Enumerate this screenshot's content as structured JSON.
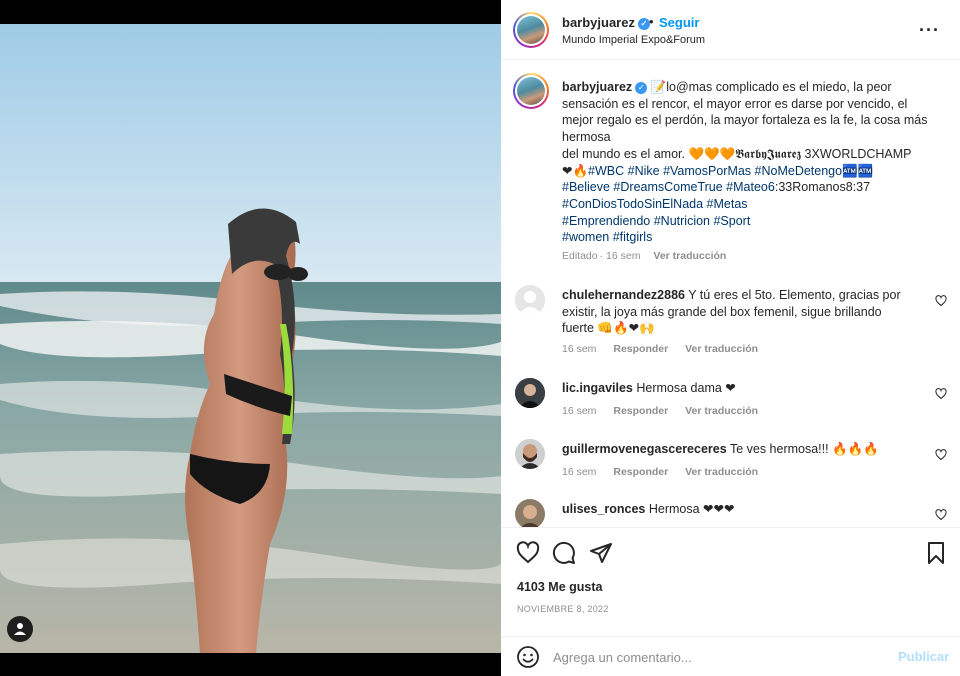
{
  "post": {
    "username": "barbyjuarez",
    "verified_mark": "✓",
    "separator": "•",
    "follow_label": "Seguir",
    "location": "Mundo Imperial Expo&Forum",
    "more_icon": "more-horizontal-icon",
    "more_label": "···"
  },
  "caption": {
    "username": "barbyjuarez",
    "line1": "📝lo@mas complicado es el miedo, la peor sensación es el rencor, el mayor error es darse por vencido, el mejor regalo es el perdón, la mayor fortaleza es la fe, la cosa más hermosa",
    "line2": "del mundo es el amor. 🧡🧡🧡𝕭𝖆𝖗𝖇𝖞𝕵𝖚𝖆𝖗𝖊𝖟 3XWORLDCHAMP",
    "line3_prefix": "❤🔥",
    "tags_a": "#WBC #Nike #VamosPorMas #NoMeDetengo",
    "line3_suffix": "🏧🏧",
    "tags_b": "#Believe #DreamsComeTrue #Mateo6",
    "line4_plain": ":33Romanos8:37",
    "tags_c": "#ConDiosTodoSinElNada #Metas",
    "tags_d": "#Emprendiendo #Nutricion #Sport",
    "tags_e": "#women #fitgirls",
    "edited": "Editado",
    "time": "16 sem",
    "translate": "Ver traducción"
  },
  "comments": [
    {
      "username": "chulehernandez2886",
      "text": "Y tú eres el 5to. Elemento, gracias por existir, la joya más grande del box femenil, sigue brillando fuerte 👊🔥❤🙌",
      "time": "16 sem",
      "reply": "Responder",
      "translate": "Ver traducción"
    },
    {
      "username": "lic.ingaviles",
      "text": "Hermosa dama ❤",
      "time": "16 sem",
      "reply": "Responder",
      "translate": "Ver traducción"
    },
    {
      "username": "guillermovenegascereceres",
      "text": "Te ves hermosa!!! 🔥🔥🔥",
      "time": "16 sem",
      "reply": "Responder",
      "translate": "Ver traducción"
    },
    {
      "username": "ulises_ronces",
      "text": "Hermosa ❤❤❤"
    }
  ],
  "actions": {
    "like_icon": "heart-outline-icon",
    "comment_icon": "comment-bubble-icon",
    "share_icon": "paper-plane-icon",
    "save_icon": "bookmark-icon",
    "likes": "4103 Me gusta",
    "date": "NOVIEMBRE 8, 2022"
  },
  "add_comment": {
    "emoji_icon": "emoji-smile-icon",
    "placeholder": "Agrega un comentario...",
    "post_label": "Publicar"
  },
  "media": {
    "tag_icon": "user-tag-icon"
  }
}
